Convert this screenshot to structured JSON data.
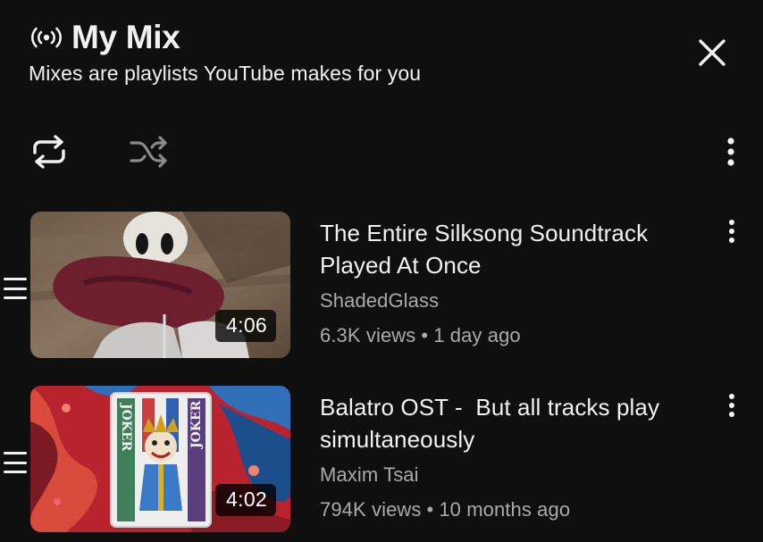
{
  "header": {
    "title": "My Mix",
    "subtitle": "Mixes are playlists YouTube makes for you",
    "icon": "broadcast-icon"
  },
  "controls": {
    "loop_icon": "loop-icon",
    "shuffle_icon": "shuffle-icon",
    "more_icon": "more-vertical-icon",
    "close_icon": "close-icon"
  },
  "videos": [
    {
      "title_line1": "The Entire Silksong Soundtrack",
      "title_line2": "Played At Once",
      "channel": "ShadedGlass",
      "views": "6.3K views",
      "age": "1 day ago",
      "duration": "4:06"
    },
    {
      "title_line1": "Balatro OST -  But all tracks play",
      "title_line2": "simultaneously",
      "channel": "Maxim Tsai",
      "views": "794K views",
      "age": "10 months ago",
      "duration": "4:02",
      "thumb_text_top": "JOKER",
      "thumb_text_bottom": "JOKER"
    }
  ],
  "separator": "•",
  "colors": {
    "background": "#0f0f0f",
    "text_primary": "#f1f1f1",
    "text_secondary": "#aaaaaa",
    "shuffle_disabled": "#8a8a8a"
  }
}
